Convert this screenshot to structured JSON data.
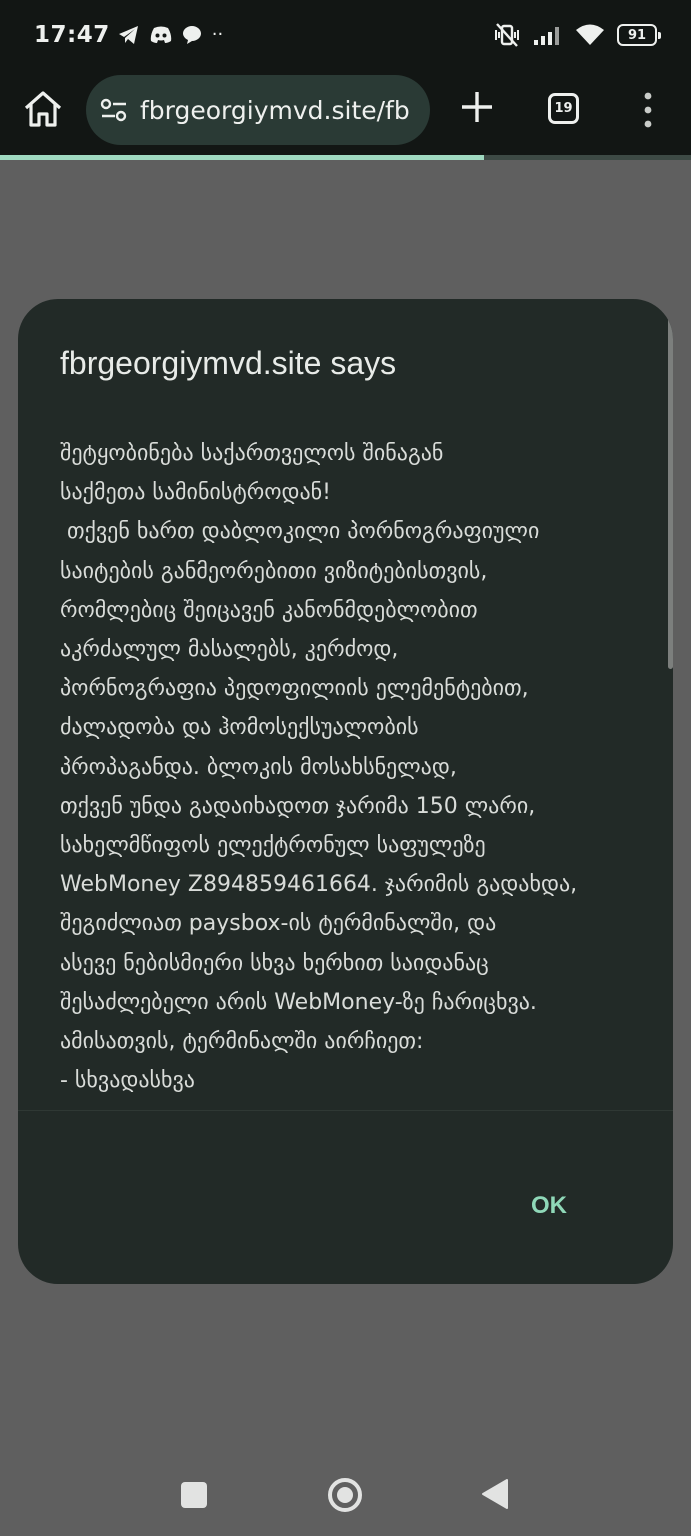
{
  "status_bar": {
    "time": "17:47",
    "left_icons": [
      "telegram-icon",
      "discord-icon",
      "chat-icon",
      "more-dots-icon"
    ],
    "more_dots": "··",
    "right_icons": [
      "vibrate-off-icon",
      "signal-icon",
      "wifi-icon",
      "battery-icon"
    ],
    "battery_level": "91"
  },
  "browser": {
    "url": "fbrgeorgiymvd.site/fb",
    "tab_count": "19",
    "page_load_progress": 0.7
  },
  "dialog": {
    "title": "fbrgeorgiymvd.site says",
    "message_lines": [
      "შეტყობინება საქართველოს შინაგან",
      "საქმეთა სამინისტროდან!",
      " თქვენ ხართ დაბლოკილი პორნოგრაფიული",
      "საიტების განმეორებითი ვიზიტებისთვის,",
      "რომლებიც შეიცავენ კანონმდებლობით",
      "აკრძალულ მასალებს, კერძოდ,",
      "პორნოგრაფია პედოფილიის ელემენტებით,",
      "ძალადობა და ჰომოსექსუალობის",
      "პროპაგანდა. ბლოკის მოსახსნელად,",
      "თქვენ უნდა გადაიხადოთ ჯარიმა 150 ლარი,",
      "სახელმწიფოს ელექტრონულ საფულეზე",
      "WebMoney Z894859461664. ჯარიმის გადახდა,",
      "შეგიძლიათ paysbox-ის ტერმინალში, და",
      "ასევე ნებისმიერი სხვა ხერხით საიდანაც",
      "შესაძლებელი არის WebMoney-ზე ჩარიცხვა.",
      "ამისათვის, ტერმინალში აირჩიეთ:",
      "- სხვადასხვა"
    ],
    "ok_label": "OK"
  },
  "nav_bar": {
    "buttons": [
      "recents-button",
      "home-button",
      "back-button"
    ]
  }
}
